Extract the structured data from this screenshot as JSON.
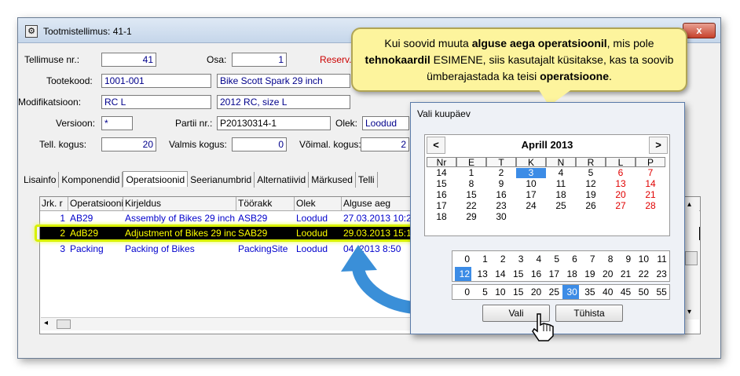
{
  "window": {
    "title": "Tootmistellimus: 41-1",
    "close_label": "x"
  },
  "form": {
    "tellimuse_label": "Tellimuse nr.:",
    "tellimuse_value": "41",
    "osa_label": "Osa:",
    "osa_value": "1",
    "reserv_label": "Reserv.",
    "tootekood_label": "Tootekood:",
    "tootekood_value": "1001-001",
    "tootekood_desc": "Bike Scott Spark 29 inch",
    "modifikatsioon_label": "Modifikatsioon:",
    "modifikatsioon_value": "RC L",
    "modifikatsioon_desc": "2012 RC, size L",
    "versioon_label": "Versioon:",
    "versioon_value": "*",
    "partii_label": "Partii nr.:",
    "partii_value": "P20130314-1",
    "olek_label": "Olek:",
    "olek_value": "Loodud",
    "tell_kogus_label": "Tell. kogus:",
    "tell_kogus_value": "20",
    "valmis_label": "Valmis kogus:",
    "valmis_value": "0",
    "voimal_label": "Võimal. kogus:",
    "voimal_value": "2"
  },
  "tabs": [
    "Lisainfo",
    "Komponendid",
    "Operatsioonid",
    "Seerianumbrid",
    "Alternatiivid",
    "Märkused",
    "Telli"
  ],
  "grid": {
    "headers": [
      "Jrk. r",
      "Operatsiooni",
      "Kirjeldus",
      "Töörakk",
      "Olek",
      "Alguse aeg"
    ],
    "rows": [
      [
        "1",
        "AB29",
        "Assembly of Bikes 29 inch",
        "ASB29",
        "Loodud",
        "27.03.2013 10:2"
      ],
      [
        "2",
        "AdB29",
        "Adjustment of Bikes 29 inch",
        "SAB29",
        "Loodud",
        "29.03.2013 15:1"
      ],
      [
        "3",
        "Packing",
        "Packing of Bikes",
        "PackingSite",
        "Loodud",
        "04.  2013 8:50"
      ]
    ]
  },
  "callout": {
    "t1": "Kui soovid muuta ",
    "b1": "alguse aega operatsioonil",
    "t2": ", mis pole ",
    "b2": "tehnokaardil",
    "t3": " ESIMENE, siis kasutajalt küsitakse, kas ta soovib ümberajastada ka teisi ",
    "b3": "operatsioone",
    "t4": "."
  },
  "dialog": {
    "title": "Vali kuupäev",
    "month": "Aprill 2013",
    "prev": "<",
    "next": ">",
    "day_headers": [
      "Nr",
      "E",
      "T",
      "K",
      "N",
      "R",
      "L",
      "P"
    ],
    "weeks": [
      [
        "14",
        "1",
        "2",
        "3",
        "4",
        "5",
        "6",
        "7"
      ],
      [
        "15",
        "8",
        "9",
        "10",
        "11",
        "12",
        "13",
        "14"
      ],
      [
        "16",
        "15",
        "16",
        "17",
        "18",
        "19",
        "20",
        "21"
      ],
      [
        "17",
        "22",
        "23",
        "24",
        "25",
        "26",
        "27",
        "28"
      ],
      [
        "18",
        "29",
        "30",
        "",
        "",
        "",
        "",
        ""
      ]
    ],
    "selected_day": "3",
    "hours_row1": [
      "0",
      "1",
      "2",
      "3",
      "4",
      "5",
      "6",
      "7",
      "8",
      "9",
      "10",
      "11"
    ],
    "hours_row2": [
      "12",
      "13",
      "14",
      "15",
      "16",
      "17",
      "18",
      "19",
      "20",
      "21",
      "22",
      "23"
    ],
    "selected_hour": "12",
    "minutes": [
      "0",
      "5",
      "10",
      "15",
      "20",
      "25",
      "30",
      "35",
      "40",
      "45",
      "50",
      "55"
    ],
    "selected_minute": "30",
    "ok_label": "Vali",
    "clear_label": "Tühista"
  },
  "colors": {
    "accent": "#3c8ce6",
    "callout_bg": "#fdf49d",
    "highlight": "#d8f000",
    "arrow": "#3a8fd8"
  }
}
